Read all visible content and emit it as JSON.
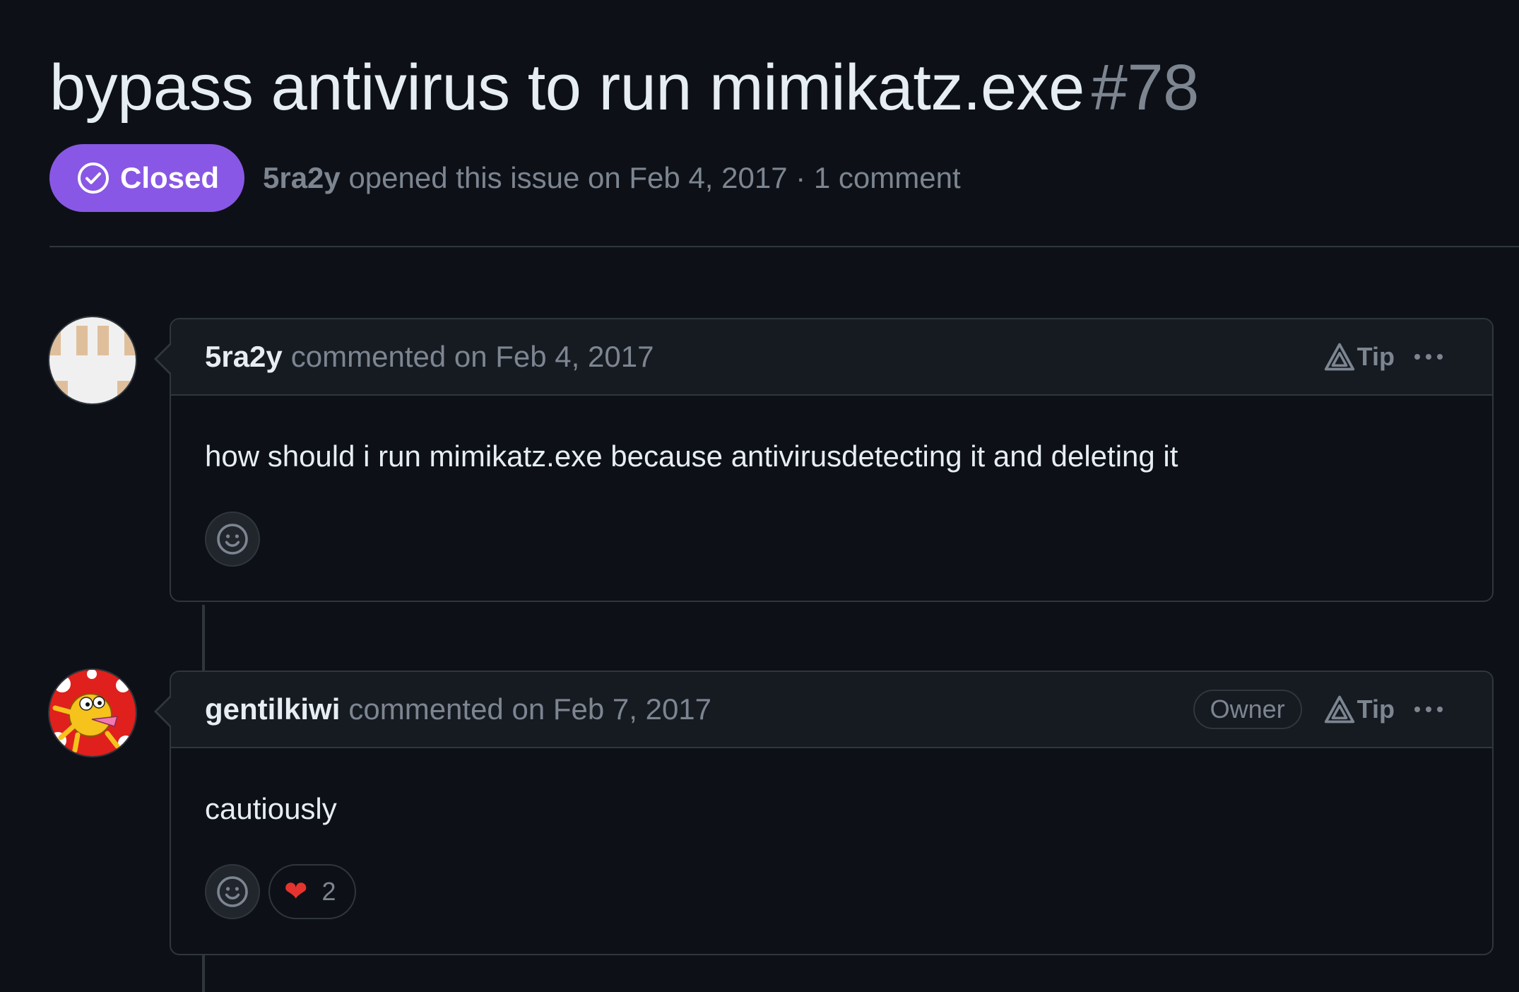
{
  "issue": {
    "title": "bypass antivirus to run mimikatz.exe",
    "number": "#78",
    "state": "Closed",
    "author": "5ra2y",
    "meta_text": "opened this issue on Feb 4, 2017 · 1 comment"
  },
  "comments": [
    {
      "author": "5ra2y",
      "meta": "commented on Feb 4, 2017",
      "tip_label": "Tip",
      "body": "how should i run mimikatz.exe because antivirusdetecting it and deleting it",
      "avatar_icon": "identicon-avatar"
    },
    {
      "author": "gentilkiwi",
      "meta": "commented on Feb 7, 2017",
      "badge": "Owner",
      "tip_label": "Tip",
      "body": "cautiously",
      "avatar_icon": "kiwi-avatar",
      "reactions": [
        {
          "emoji": "❤",
          "name": "heart",
          "count": "2"
        }
      ]
    }
  ],
  "colors": {
    "background": "#0d1117",
    "closed_badge": "#8957e5",
    "border": "#30363d",
    "muted_text": "#7d8590",
    "heart": "#e5342f"
  }
}
